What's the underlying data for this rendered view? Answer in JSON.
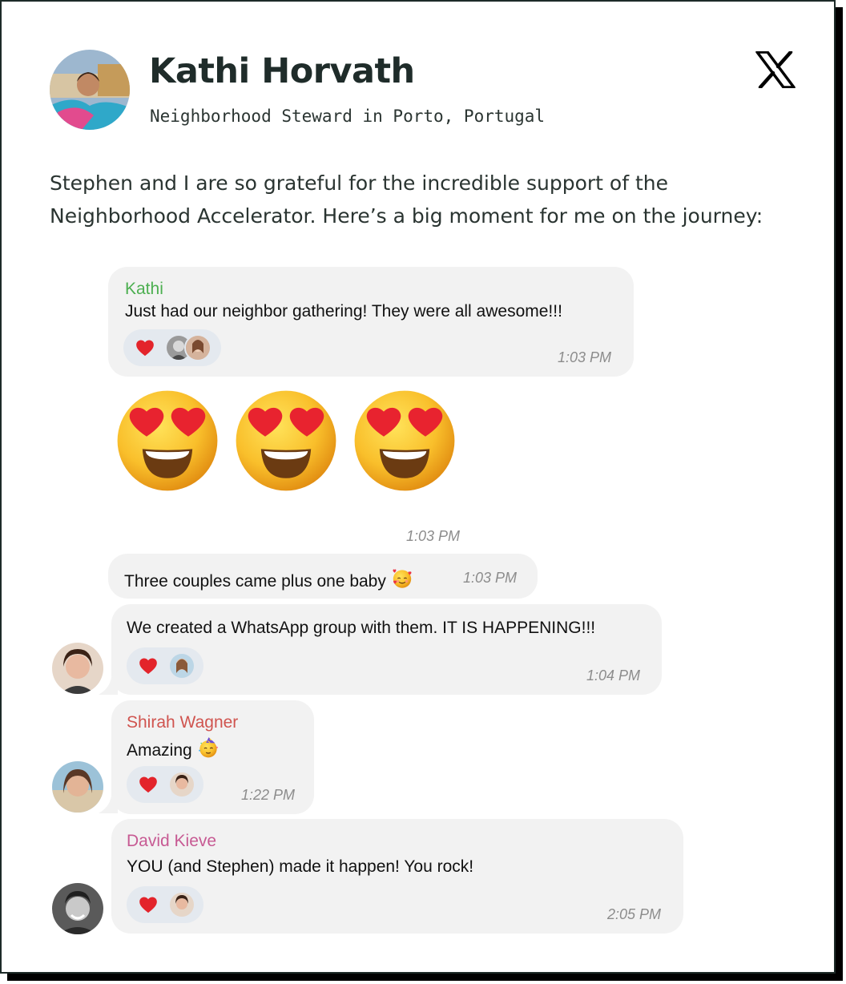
{
  "post": {
    "author_name": "Kathi Horvath",
    "author_role": "Neighborhood Steward in Porto, Portugal",
    "platform_icon": "x-logo-icon",
    "text": "Stephen and I are so grateful for the incredible support of the Neighborhood Accelerator. Here’s a big moment for me on the journey:"
  },
  "chat": {
    "messages": [
      {
        "sender": "Kathi",
        "sender_color": "#4caf50",
        "text": "Just had our neighbor gathering! They were all awesome!!!",
        "reaction": "heart",
        "time": "1:03 PM"
      },
      {
        "emojis": [
          "heart-eyes-emoji",
          "heart-eyes-emoji",
          "heart-eyes-emoji"
        ],
        "time": "1:03 PM"
      },
      {
        "text": "Three couples came plus one baby",
        "emoji": "smiling-face-with-hearts-emoji",
        "time": "1:03 PM"
      },
      {
        "text": "We created a WhatsApp group with them. IT IS HAPPENING!!!",
        "reaction": "heart",
        "time": "1:04 PM"
      },
      {
        "sender": "Shirah Wagner",
        "sender_color": "#d0544f",
        "text": "Amazing",
        "emoji": "partying-face-emoji",
        "reaction": "heart",
        "time": "1:22 PM"
      },
      {
        "sender": "David Kieve",
        "sender_color": "#c75a93",
        "text": "YOU (and Stephen) made it happen! You rock!",
        "reaction": "heart",
        "time": "2:05 PM"
      }
    ]
  },
  "colors": {
    "bubble": "#f2f2f2",
    "reaction_pill": "#e4e9ef",
    "heart": "#e3242b",
    "border": "#1d2b28"
  }
}
